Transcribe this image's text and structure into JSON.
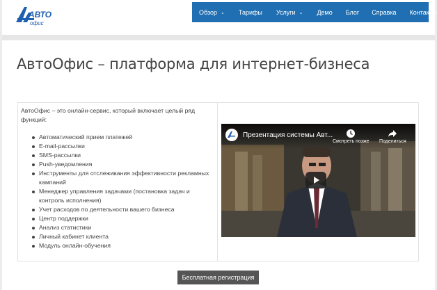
{
  "logo": {
    "top_text": "АВТО",
    "bottom_text": "офис"
  },
  "nav": {
    "items": [
      {
        "label": "Обзор",
        "dropdown": true
      },
      {
        "label": "Тарифы",
        "dropdown": false
      },
      {
        "label": "Услуги",
        "dropdown": true
      },
      {
        "label": "Демо",
        "dropdown": false
      },
      {
        "label": "Блог",
        "dropdown": false
      },
      {
        "label": "Справка",
        "dropdown": false
      },
      {
        "label": "Контакты",
        "dropdown": false
      }
    ],
    "chevron": "⌄"
  },
  "page": {
    "title": "АвтоОфис – платформа для интернет-бизнеса",
    "intro": "АвтоОфис – это онлайн-сервис, который включает целый ряд функций:",
    "features": [
      "Автоматический прием платежей",
      "E-mail-рассылки",
      "SMS-рассылки",
      "Push-уведомления",
      "Инструменты для отслеживания эффективности рекламных кампаний",
      "Менеджер управления задачами (постановка задач и контроль исполнения)",
      "Учет расходов по деятельности вашего бизнеса",
      "Центр поддержки",
      "Анализ статистики",
      "Личный кабинет клиента",
      "Модуль онлайн-обучения"
    ]
  },
  "video": {
    "title": "Презентация системы Авт...",
    "watch_later": "Смотреть позже",
    "share": "Поделиться"
  },
  "cta": {
    "label": "Бесплатная регистрация"
  },
  "colors": {
    "nav_bg": "#1f6fb2",
    "button_bg": "#555555",
    "logo_blue": "#1f5fb0"
  }
}
